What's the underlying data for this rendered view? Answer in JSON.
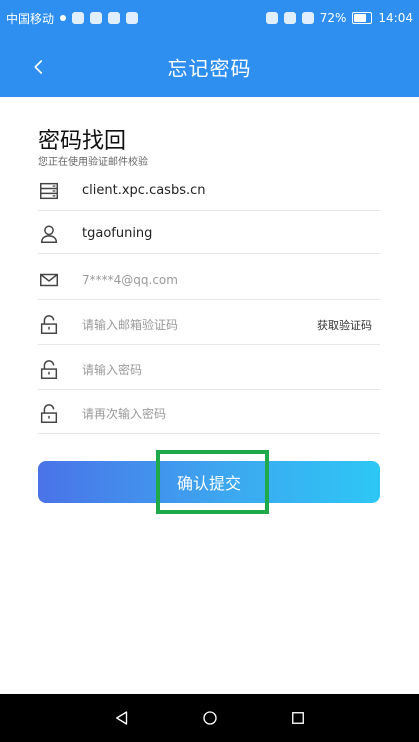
{
  "status_bar": {
    "carrier": "中国移动",
    "battery": "72%",
    "time": "14:04",
    "battery_level": 0.72
  },
  "header": {
    "title": "忘记密码",
    "back_icon": "chevron-left-icon"
  },
  "form": {
    "heading": "密码找回",
    "subheading": "您正在使用验证邮件校验",
    "server": {
      "icon": "server-icon",
      "value": "client.xpc.casbs.cn"
    },
    "username": {
      "icon": "user-icon",
      "value": "tgaofuning"
    },
    "email": {
      "icon": "mail-icon",
      "placeholder": "7****4@qq.com"
    },
    "code": {
      "icon": "lock-icon",
      "placeholder": "请输入邮箱验证码",
      "action_label": "获取验证码"
    },
    "password": {
      "icon": "lock-icon",
      "placeholder": "请输入密码"
    },
    "password_confirm": {
      "icon": "lock-icon",
      "placeholder": "请再次输入密码"
    },
    "submit_label": "确认提交"
  },
  "colors": {
    "primary": "#2e8ff0",
    "highlight": "#1eaa4b",
    "button_gradient_start": "#4a73e8",
    "button_gradient_end": "#2dc7f5"
  },
  "nav": {
    "back_icon": "triangle-back-icon",
    "home_icon": "circle-home-icon",
    "recent_icon": "square-recent-icon"
  }
}
